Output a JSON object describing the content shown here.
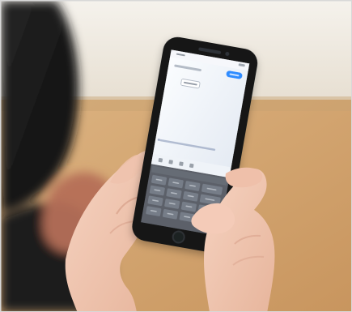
{
  "scene": {
    "subject": "person-typing-on-smartphone",
    "colors": {
      "wall": "#e9e1d3",
      "table": "#d8a873",
      "hair": "#171717",
      "skin": "#f2c9b4",
      "phone_body": "#121315",
      "screen": "#eef2f8",
      "keyboard": "#5b6069",
      "accent_button": "#2f8cff"
    }
  },
  "phone_screen": {
    "status_time": "",
    "header_text": "",
    "post_button": "",
    "chip_text": "",
    "footer_text": "",
    "keyboard_top_row": [],
    "keyboard_rows": []
  }
}
